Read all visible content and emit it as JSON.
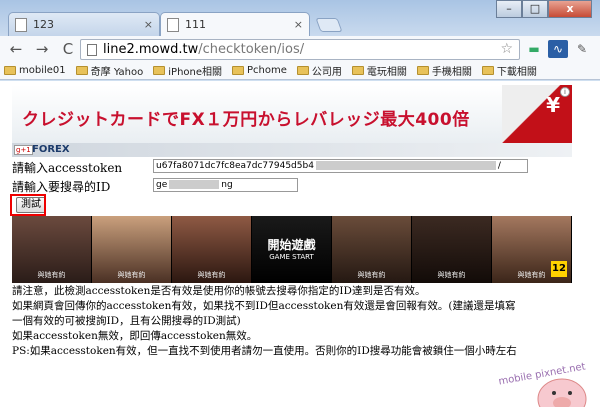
{
  "tabs": [
    {
      "title": "123",
      "close": "×"
    },
    {
      "title": "111",
      "close": "×"
    }
  ],
  "window_controls": {
    "min": "–",
    "max": "□",
    "close": "x"
  },
  "toolbar": {
    "back": "←",
    "forward": "→",
    "reload": "C",
    "star": "☆"
  },
  "address": {
    "host": "line2.mowd.tw",
    "path": "/checktoken/ios/"
  },
  "bookmarks": [
    "mobile01",
    "奇摩 Yahoo",
    "iPhone相關",
    "Pchome",
    "公司用",
    "電玩相關",
    "手機相關",
    "下載相關"
  ],
  "banner": {
    "text": "クレジットカードでFX１万円からレバレッジ最大400倍",
    "brand": "FOREX",
    "info": "i",
    "gplus": "g+1",
    "yen": "¥"
  },
  "form": {
    "token_label": "請輸入accesstoken",
    "token_value_start": "u67fa8071dc7fc8ea7dc77945d5b4",
    "token_value_end": "/",
    "id_label": "請輸入要搜尋的ID",
    "id_value_start": "ge",
    "id_value_end": "ng",
    "button": "測試"
  },
  "thumbs": [
    {
      "label": "與她有約",
      "center": "",
      "sub": ""
    },
    {
      "label": "與她有約",
      "center": "",
      "sub": ""
    },
    {
      "label": "與她有約",
      "center": "",
      "sub": ""
    },
    {
      "label": "",
      "center": "開始遊戲",
      "sub": "GAME START"
    },
    {
      "label": "與她有約",
      "center": "",
      "sub": ""
    },
    {
      "label": "與她有約",
      "center": "",
      "sub": ""
    },
    {
      "label": "與她有約",
      "center": "",
      "sub": ""
    }
  ],
  "rating": "12",
  "notice": [
    "請注意，此檢測accesstoken是否有效是使用你的帳號去搜尋你指定的ID達到是否有效。",
    "如果網頁會回傳你的accesstoken有效，如果找不到ID但accesstoken有效還是會回報有效。(建議還是填寫",
    "一個有效的可被搜詢ID，且有公開搜尋的ID測試)",
    "如果accesstoken無效，即回傳accesstoken無效。",
    "PS:如果accesstoken有效，但一直找不到使用者請勿一直使用。否則你的ID搜尋功能會被鎖住一個小時左右"
  ],
  "watermark": "mobile pixnet.net"
}
